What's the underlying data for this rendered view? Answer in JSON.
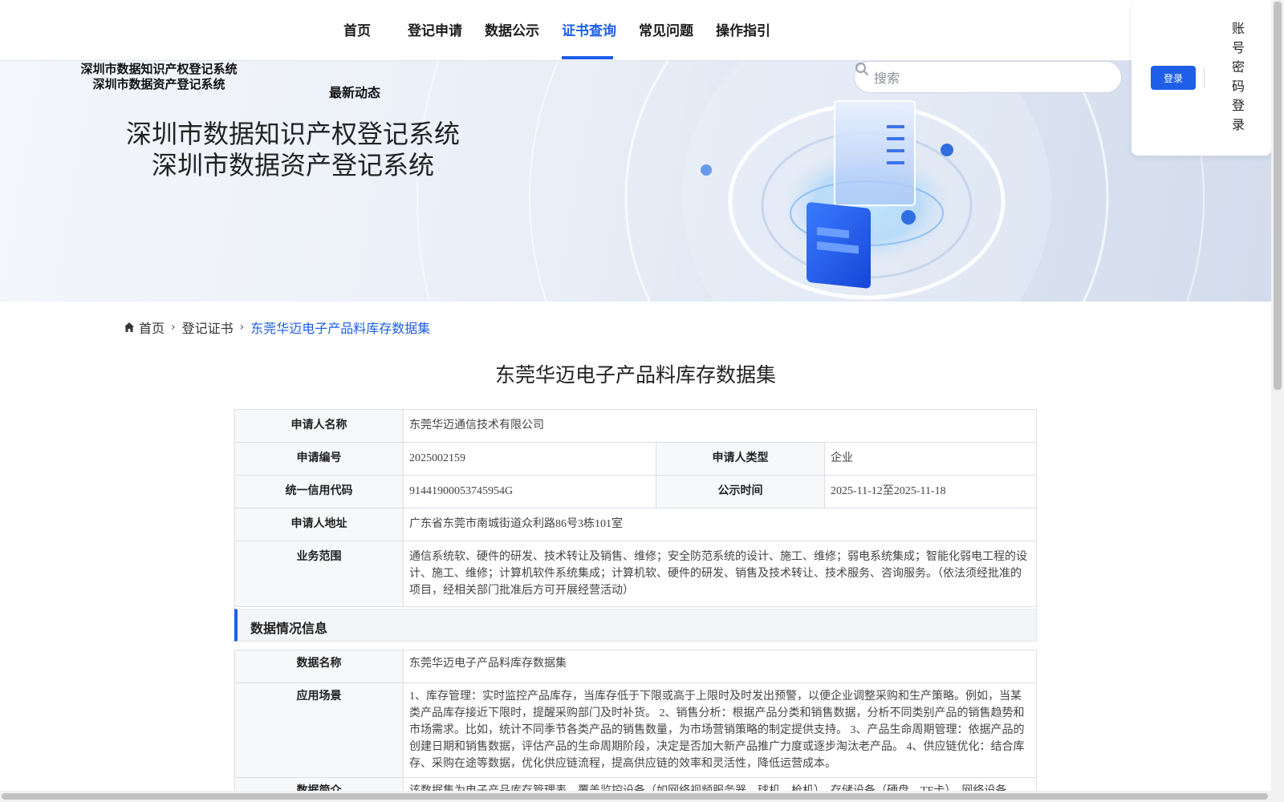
{
  "nav": {
    "items": [
      {
        "label": "首页",
        "active": false
      },
      {
        "label": "登记申请",
        "active": false
      },
      {
        "label": "数据公示",
        "active": false
      },
      {
        "label": "证书查询",
        "active": true
      },
      {
        "label": "常见问题",
        "active": false
      },
      {
        "label": "操作指引",
        "active": false
      }
    ]
  },
  "banner": {
    "system_name_line1": "深圳市数据知识产权登记系统",
    "system_name_line2": "深圳市数据资产登记系统",
    "latest_news": "最新动态",
    "title_line1": "深圳市数据知识产权登记系统",
    "title_line2": "深圳市数据资产登记系统"
  },
  "search": {
    "placeholder": "搜索",
    "value": ""
  },
  "login": {
    "button_label": "登录",
    "password_login_label": "账号密码登录"
  },
  "breadcrumb": {
    "home": "首页",
    "level2": "登记证书",
    "current": "东莞华迈电子产品料库存数据集"
  },
  "page_title": "东莞华迈电子产品料库存数据集",
  "applicant_info": {
    "applicant_name_label": "申请人名称",
    "applicant_name": "东莞华迈通信技术有限公司",
    "application_no_label": "申请编号",
    "application_no": "2025002159",
    "applicant_type_label": "申请人类型",
    "applicant_type": "企业",
    "credit_code_label": "统一信用代码",
    "credit_code": "91441900053745954G",
    "publicity_time_label": "公示时间",
    "publicity_time": "2025-11-12至2025-11-18",
    "address_label": "申请人地址",
    "address": "广东省东莞市南城街道众利路86号3栋101室",
    "business_scope_label": "业务范围",
    "business_scope": "通信系统软、硬件的研发、技术转让及销售、维修；安全防范系统的设计、施工、维修；弱电系统集成；智能化弱电工程的设计、施工、维修；计算机软件系统集成；计算机软、硬件的研发、销售及技术转让、技术服务、咨询服务。（依法须经批准的项目，经相关部门批准后方可开展经营活动）"
  },
  "data_section": {
    "heading": "数据情况信息",
    "data_name_label": "数据名称",
    "data_name": "东莞华迈电子产品料库存数据集",
    "scenario_label": "应用场景",
    "scenario": "1、库存管理：实时监控产品库存，当库存低于下限或高于上限时及时发出预警，以便企业调整采购和生产策略。例如，当某类产品库存接近下限时，提醒采购部门及时补货。 2、销售分析：根据产品分类和销售数据，分析不同类别产品的销售趋势和市场需求。比如，统计不同季节各类产品的销售数量，为市场营销策略的制定提供支持。 3、产品生命周期管理：依据产品的创建日期和销售数据，评估产品的生命周期阶段，决定是否加大新产品推广力度或逐步淘汰老产品。 4、供应链优化：结合库存、采购在途等数据，优化供应链流程，提高供应链的效率和灵活性，降低运营成本。",
    "summary_label": "数据简介",
    "summary": "该数据集为电子产品库存管理表，覆盖监控设备（如网络视频服务器、球机、枪机）、存储设备（硬盘、TF卡）、网络设备"
  },
  "colors": {
    "accent": "#1e5ee8",
    "border": "#dcdfe6",
    "label_bg": "#f7f8fa"
  }
}
